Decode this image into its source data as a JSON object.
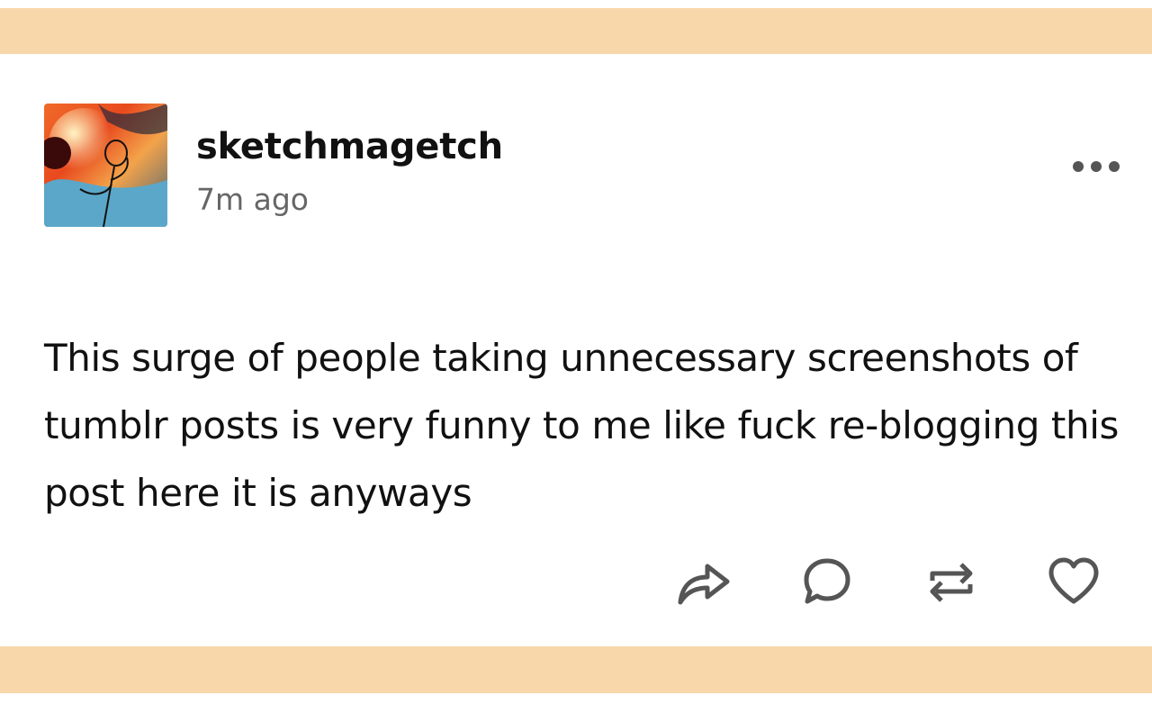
{
  "colors": {
    "band": "#f8d7ab",
    "text": "#111111",
    "muted": "#666666",
    "icon": "#555555"
  },
  "post": {
    "username": "sketchmagetch",
    "timestamp": "7m ago",
    "body": "This surge of people taking unnecessary screenshots of tumblr posts is very funny to me like fuck re-blogging this post here it is anyways"
  },
  "icons": {
    "avatar": "avatar-image",
    "more": "more-options-icon",
    "share": "share-icon",
    "reply": "reply-icon",
    "reblog": "reblog-icon",
    "like": "heart-icon"
  }
}
